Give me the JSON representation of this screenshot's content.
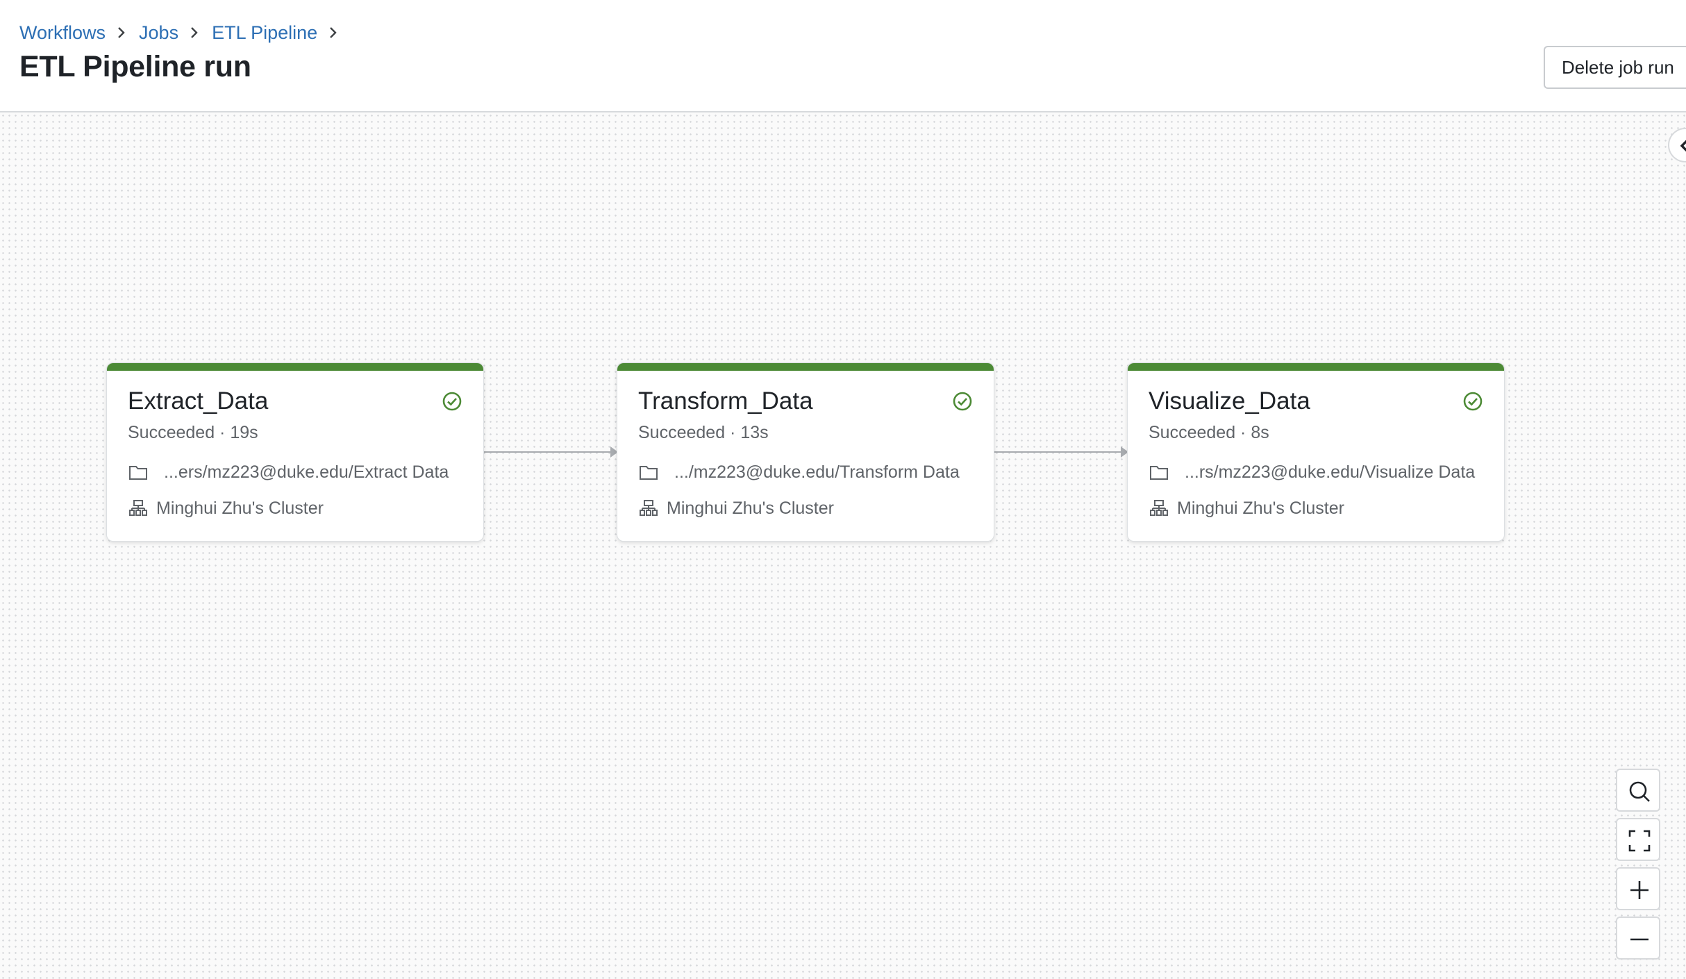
{
  "breadcrumb": [
    "Workflows",
    "Jobs",
    "ETL Pipeline"
  ],
  "title": "ETL Pipeline run",
  "actions": {
    "delete_label": "Delete job run"
  },
  "tasks": [
    {
      "name": "Extract_Data",
      "status": "Succeeded · 19s",
      "path": "...ers/mz223@duke.edu/Extract Data",
      "cluster": "Minghui Zhu's Cluster"
    },
    {
      "name": "Transform_Data",
      "status": "Succeeded · 13s",
      "path": ".../mz223@duke.edu/Transform Data",
      "cluster": "Minghui Zhu's Cluster"
    },
    {
      "name": "Visualize_Data",
      "status": "Succeeded · 8s",
      "path": "...rs/mz223@duke.edu/Visualize Data",
      "cluster": "Minghui Zhu's Cluster"
    }
  ],
  "colors": {
    "success": "#4c8a35",
    "link": "#2d6fb4"
  },
  "icons": {
    "task": [
      "success-check-icon",
      "folder-icon",
      "cluster-icon"
    ],
    "canvas_controls": [
      "search-icon",
      "fit-view-icon",
      "zoom-in-icon",
      "zoom-out-icon"
    ],
    "panel": "chevron-left-icon"
  }
}
